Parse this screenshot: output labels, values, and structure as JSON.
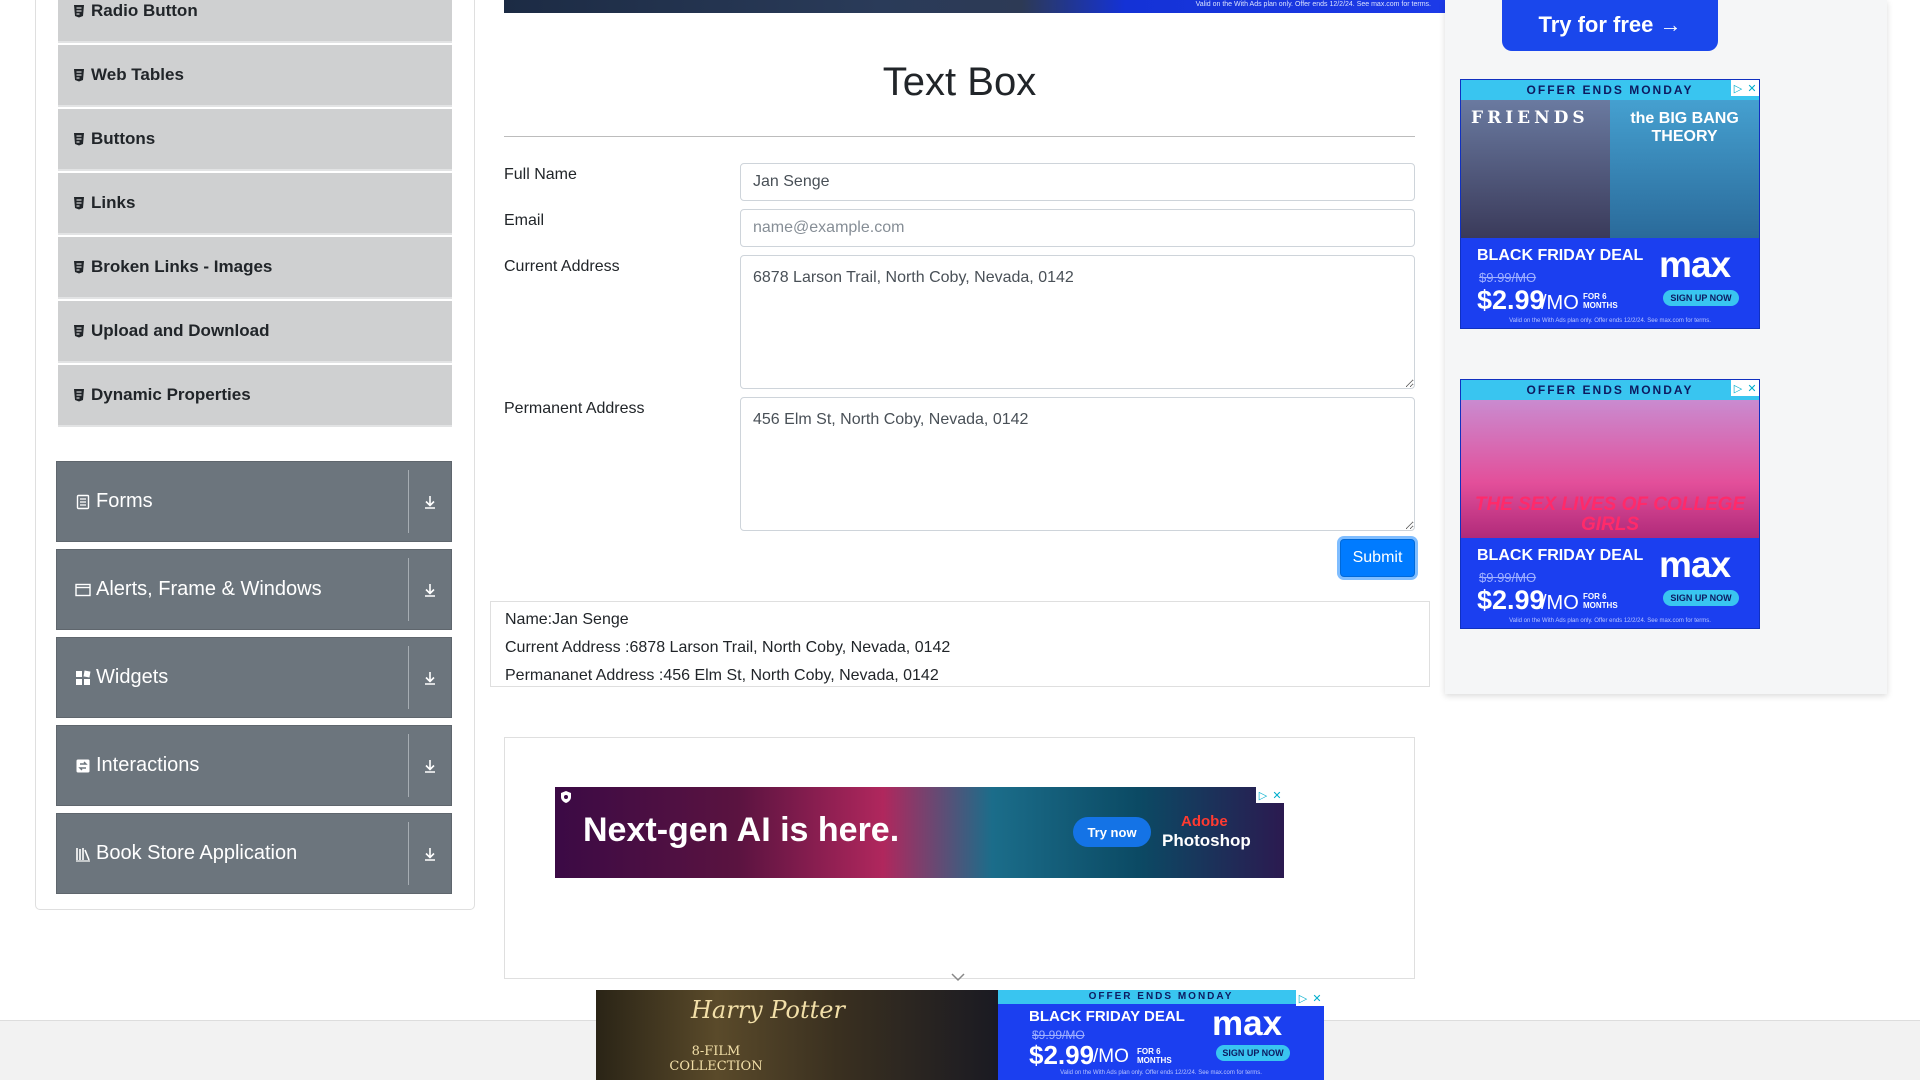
{
  "sidebar": {
    "elements_items": [
      {
        "label": "Radio Button"
      },
      {
        "label": "Web Tables"
      },
      {
        "label": "Buttons"
      },
      {
        "label": "Links"
      },
      {
        "label": "Broken Links - Images"
      },
      {
        "label": "Upload and Download"
      },
      {
        "label": "Dynamic Properties"
      }
    ],
    "groups": [
      {
        "label": "Forms",
        "icon": "form-icon"
      },
      {
        "label": "Alerts, Frame & Windows",
        "icon": "window-icon"
      },
      {
        "label": "Widgets",
        "icon": "widgets-icon"
      },
      {
        "label": "Interactions",
        "icon": "interactions-icon"
      },
      {
        "label": "Book Store Application",
        "icon": "book-icon"
      }
    ]
  },
  "main": {
    "title": "Text Box",
    "form": {
      "full_name_label": "Full Name",
      "full_name_value": "Jan Senge",
      "email_label": "Email",
      "email_placeholder": "name@example.com",
      "current_address_label": "Current Address",
      "current_address_value": "6878 Larson Trail, North Coby, Nevada, 0142",
      "permanent_address_label": "Permanent Address",
      "permanent_address_value": "456 Elm St, North Coby, Nevada, 0142",
      "submit_label": "Submit"
    },
    "output": {
      "name": "Name:Jan Senge",
      "current_address": "Current Address :6878 Larson Trail, North Coby, Nevada, 0142",
      "permanent_address": "Permananet Address :456 Elm St, North Coby, Nevada, 0142"
    }
  },
  "ads": {
    "top_banner_fine": "Valid on the With Ads plan only. Offer ends 12/2/24. See max.com for terms.",
    "try_button": "Try for free →",
    "photoshop": {
      "headline": "Next-gen AI is here.",
      "cta": "Try now",
      "brand_line1": "Adobe",
      "brand_line2": "Photoshop"
    },
    "max_ad_1": {
      "offer": "OFFER ENDS MONDAY",
      "show1": "FRIENDS",
      "show2": "the BIG BANG THEORY",
      "deal": "BLACK FRIDAY DEAL",
      "old_price": "$9.99/MO",
      "price": "$2.99",
      "per": "/MO",
      "for": "FOR 6 MONTHS",
      "logo": "max",
      "signup": "SIGN UP NOW",
      "fine": "Valid on the With Ads plan only. Offer ends 12/2/24. See max.com for terms."
    },
    "max_ad_2": {
      "offer": "OFFER ENDS MONDAY",
      "show": "THE SEX LIVES OF COLLEGE GIRLS",
      "deal": "BLACK FRIDAY DEAL",
      "old_price": "$9.99/MO",
      "price": "$2.99",
      "per": "/MO",
      "for": "FOR 6 MONTHS",
      "logo": "max",
      "signup": "SIGN UP NOW",
      "fine": "Valid on the With Ads plan only. Offer ends 12/2/24. See max.com for terms."
    },
    "bottom": {
      "hp_title": "Harry Potter",
      "hp_sub": "8-FILM COLLECTION",
      "offer": "OFFER ENDS MONDAY",
      "deal": "BLACK FRIDAY DEAL",
      "old_price": "$9.99/MO",
      "price": "$2.99",
      "per": "/MO",
      "for": "FOR 6 MONTHS",
      "logo": "max",
      "signup": "SIGN UP NOW",
      "fine": "Valid on the With Ads plan only. Offer ends 12/2/24. See max.com for terms."
    }
  },
  "colors": {
    "primary": "#007bff",
    "sidebar_group": "#6c757d",
    "sidebar_item": "#cfd0d1",
    "max_blue": "#1b3ff0"
  }
}
